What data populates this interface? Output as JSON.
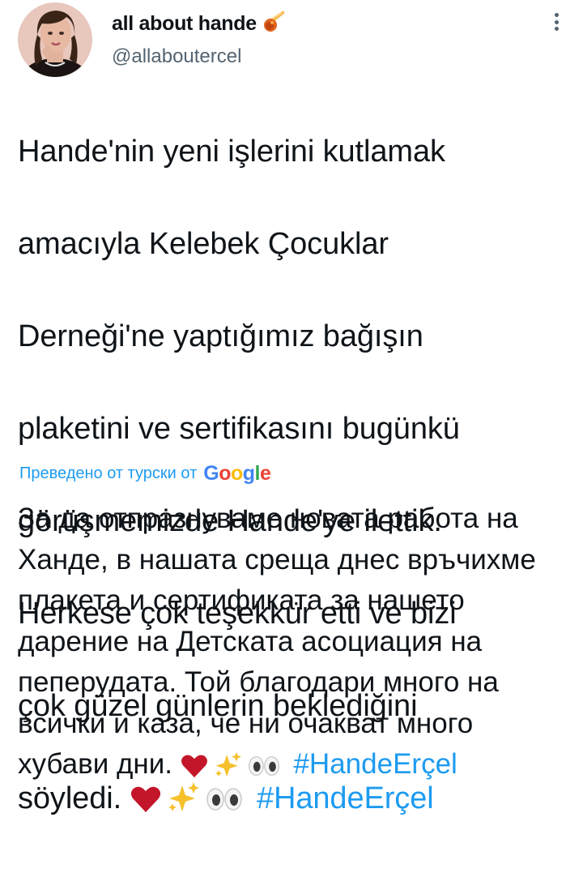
{
  "header": {
    "author_name": "all about hande",
    "handle": "@allaboutercel",
    "name_emoji": "comet-icon",
    "more_icon": "more-vertical-icon"
  },
  "tweet": {
    "lines": [
      "Hande'nin yeni işlerini kutlamak",
      "amacıyla Kelebek Çocuklar",
      "Derneği'ne yaptığımız bağışın",
      "plaketini ve sertifikasını bugünkü",
      "görüşmemizde Hande'ye ilettik.",
      "Herkese çok teşekkür etti ve bizi",
      "çok güzel günlerin beklediğini"
    ],
    "last_line_text": "söyledi.",
    "emojis": [
      "heart-icon",
      "sparkles-icon",
      "eyes-icon"
    ],
    "hashtag": "#HandeErçel"
  },
  "translation_bar": {
    "label": "Преведено от турски от",
    "google_logo": "Google",
    "brand_colors": [
      "#4285f4",
      "#ea4335",
      "#fbbc05",
      "#4285f4",
      "#34a853",
      "#ea4335"
    ]
  },
  "translation": {
    "lines": [
      "За да отпразнуваме новата работа на",
      "Ханде, в нашата среща днес връчихме",
      "плакета и сертификата за нашето",
      "дарение на Детската асоциация на",
      "пеперудата. Той благодари много на",
      "всички и каза, че ни очакват много"
    ],
    "last_line_text": "хубави дни.",
    "hashtag": "#HandeErçel"
  }
}
